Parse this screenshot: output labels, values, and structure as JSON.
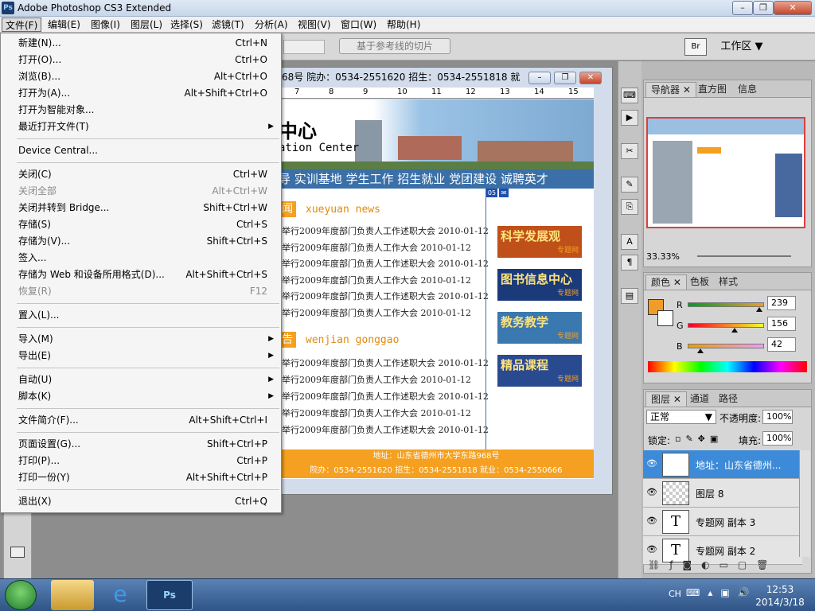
{
  "window": {
    "title": "Adobe Photoshop CS3 Extended",
    "logo": "Ps"
  },
  "menubar": [
    "文件(F)",
    "编辑(E)",
    "图像(I)",
    "图层(L)",
    "选择(S)",
    "滤镜(T)",
    "分析(A)",
    "视图(V)",
    "窗口(W)",
    "帮助(H)"
  ],
  "optionsbar": {
    "slice_button": "基于参考线的切片",
    "workspace": "工作区 ▼"
  },
  "file_menu": [
    {
      "label": "新建(N)...",
      "shortcut": "Ctrl+N"
    },
    {
      "label": "打开(O)...",
      "shortcut": "Ctrl+O"
    },
    {
      "label": "浏览(B)...",
      "shortcut": "Alt+Ctrl+O"
    },
    {
      "label": "打开为(A)...",
      "shortcut": "Alt+Shift+Ctrl+O"
    },
    {
      "label": "打开为智能对象...",
      "shortcut": ""
    },
    {
      "label": "最近打开文件(T)",
      "shortcut": "",
      "submenu": true
    },
    {
      "sep": true
    },
    {
      "label": "Device Central...",
      "shortcut": ""
    },
    {
      "sep": true
    },
    {
      "label": "关闭(C)",
      "shortcut": "Ctrl+W"
    },
    {
      "label": "关闭全部",
      "shortcut": "Alt+Ctrl+W",
      "disabled": true
    },
    {
      "label": "关闭并转到 Bridge...",
      "shortcut": "Shift+Ctrl+W"
    },
    {
      "label": "存储(S)",
      "shortcut": "Ctrl+S"
    },
    {
      "label": "存储为(V)...",
      "shortcut": "Shift+Ctrl+S"
    },
    {
      "label": "签入...",
      "shortcut": ""
    },
    {
      "label": "存储为 Web 和设备所用格式(D)...",
      "shortcut": "Alt+Shift+Ctrl+S"
    },
    {
      "label": "恢复(R)",
      "shortcut": "F12",
      "disabled": true
    },
    {
      "sep": true
    },
    {
      "label": "置入(L)...",
      "shortcut": ""
    },
    {
      "sep": true
    },
    {
      "label": "导入(M)",
      "shortcut": "",
      "submenu": true
    },
    {
      "label": "导出(E)",
      "shortcut": "",
      "submenu": true
    },
    {
      "sep": true
    },
    {
      "label": "自动(U)",
      "shortcut": "",
      "submenu": true
    },
    {
      "label": "脚本(K)",
      "shortcut": "",
      "submenu": true
    },
    {
      "sep": true
    },
    {
      "label": "文件简介(F)...",
      "shortcut": "Alt+Shift+Ctrl+I"
    },
    {
      "sep": true
    },
    {
      "label": "页面设置(G)...",
      "shortcut": "Shift+Ctrl+P"
    },
    {
      "label": "打印(P)...",
      "shortcut": "Ctrl+P"
    },
    {
      "label": "打印一份(Y)",
      "shortcut": "Alt+Shift+Ctrl+P"
    },
    {
      "sep": true
    },
    {
      "label": "退出(X)",
      "shortcut": "Ctrl+Q"
    }
  ],
  "document": {
    "title": "68号 院办：0534-2551620 招生：0534-2551818 就...",
    "ruler": [
      "7",
      "8",
      "9",
      "10",
      "11",
      "12",
      "13",
      "14",
      "15"
    ],
    "logo_text": "中心",
    "sub_text": "ation Center",
    "nav": "导 实训基地 学生工作 招生就业 党团建设 诚聘英才",
    "news_head": "闻",
    "news_head_en": "xueyuan news",
    "news": [
      "举行2009年度部门负责人工作述职大会    2010-01-12",
      "举行2009年度部门负责人工作大会    2010-01-12",
      "举行2009年度部门负责人工作述职大会    2010-01-12",
      "举行2009年度部门负责人工作大会    2010-01-12",
      "举行2009年度部门负责人工作述职大会    2010-01-12",
      "举行2009年度部门负责人工作大会    2010-01-12"
    ],
    "notice_head": "告",
    "notice_head_en": "wenjian gonggao",
    "notices": [
      "举行2009年度部门负责人工作述职大会    2010-01-12",
      "举行2009年度部门负责人工作大会    2010-01-12",
      "举行2009年度部门负责人工作述职大会    2010-01-12",
      "举行2009年度部门负责人工作大会    2010-01-12",
      "举行2009年度部门负责人工作述职大会    2010-01-12"
    ],
    "banners": [
      {
        "title": "科学发展观",
        "tag": "专题网"
      },
      {
        "title": "图书信息中心",
        "tag": "专题网"
      },
      {
        "title": "教务教学",
        "tag": "专题网"
      },
      {
        "title": "精品课程",
        "tag": "专题网"
      }
    ],
    "slice_tag": "05",
    "footer1": "地址：山东省德州市大学东路968号",
    "footer2": "院办：0534-2551620  招生：0534-2551818  就业：0534-2550666"
  },
  "panels": {
    "navigator_tabs": [
      "导航器",
      "直方图",
      "信息"
    ],
    "zoom": "33.33%",
    "color_tabs": [
      "颜色",
      "色板",
      "样式"
    ],
    "color": {
      "r": "239",
      "g": "156",
      "b": "42",
      "r_label": "R",
      "g_label": "G",
      "b_label": "B",
      "swatch": "#ef9c2a",
      "r_level": 0.937,
      "g_level": 0.612,
      "b_level": 0.165
    },
    "layers_tabs": [
      "图层",
      "通道",
      "路径"
    ],
    "blend_mode": "正常",
    "opacity_label": "不透明度:",
    "opacity": "100%",
    "lock_label": "锁定:",
    "fill_label": "填充:",
    "fill": "100%",
    "layers": [
      {
        "name": "地址：山东省德州...",
        "thumb": "T",
        "selected": true
      },
      {
        "name": "图层 8",
        "thumb": "",
        "selected": false
      },
      {
        "name": "专题网 副本 3",
        "thumb": "T",
        "selected": false
      },
      {
        "name": "专题网 副本 2",
        "thumb": "T",
        "selected": false
      }
    ]
  },
  "taskbar": {
    "lang": "CH",
    "time": "12:53",
    "date": "2014/3/18"
  }
}
